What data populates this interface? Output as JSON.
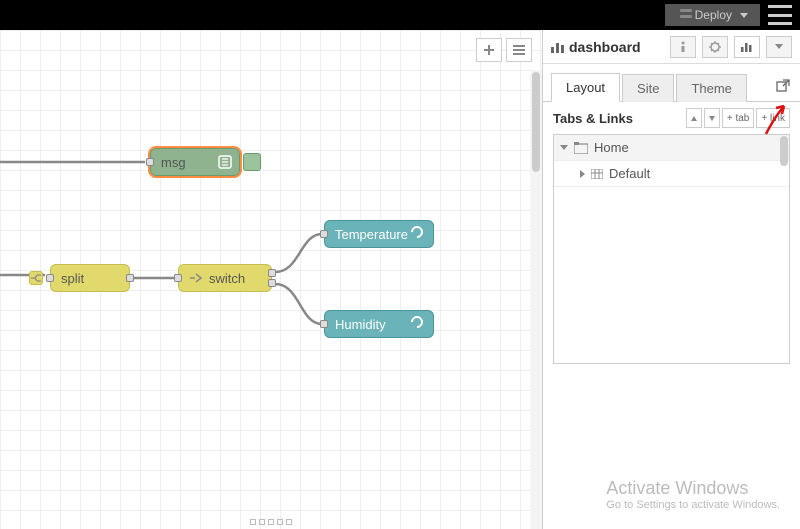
{
  "topbar": {
    "deploy_label": "Deploy"
  },
  "sidebar": {
    "title": "dashboard",
    "tabs": {
      "layout": "Layout",
      "site": "Site",
      "theme": "Theme"
    },
    "section_title": "Tabs & Links",
    "buttons": {
      "add_tab": "+ tab",
      "add_link": "+ link"
    },
    "tree": {
      "root": "Home",
      "child": "Default"
    }
  },
  "nodes": {
    "msg": "msg",
    "split": "split",
    "switch": "switch",
    "temperature": "Temperature",
    "humidity": "Humidity"
  },
  "watermark": {
    "line1": "Activate Windows",
    "line2": "Go to Settings to activate Windows."
  },
  "colors": {
    "node_yellow": "#e2d96d",
    "node_teal": "#6ab3b8",
    "node_green": "#8fb38f",
    "selection": "#ff8c42"
  }
}
